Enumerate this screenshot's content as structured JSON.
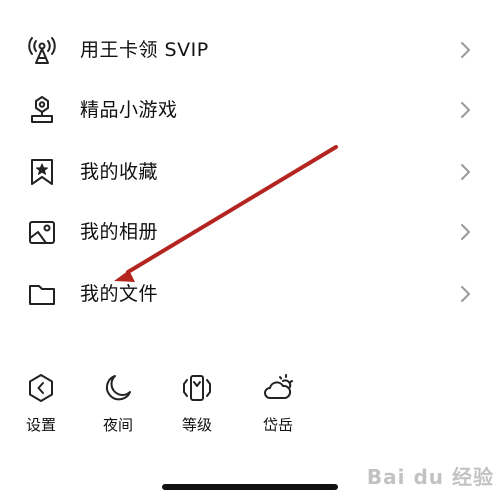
{
  "menu": {
    "items": [
      {
        "label": "用王卡领 SVIP",
        "icon": "broadcast-tower-icon"
      },
      {
        "label": "精品小游戏",
        "icon": "game-controller-icon"
      },
      {
        "label": "我的收藏",
        "icon": "bookmark-star-icon"
      },
      {
        "label": "我的相册",
        "icon": "photo-album-icon"
      },
      {
        "label": "我的文件",
        "icon": "folder-icon"
      }
    ]
  },
  "bottom_bar": {
    "items": [
      {
        "label": "设置",
        "icon": "settings-hexagon-icon"
      },
      {
        "label": "夜间",
        "icon": "moon-icon"
      },
      {
        "label": "等级",
        "icon": "level-phone-icon"
      },
      {
        "label": "岱岳",
        "icon": "weather-cloud-sun-icon"
      }
    ]
  },
  "annotation": {
    "arrow_color": "#b5251f"
  },
  "watermark": {
    "text": "Bai du 经验"
  }
}
